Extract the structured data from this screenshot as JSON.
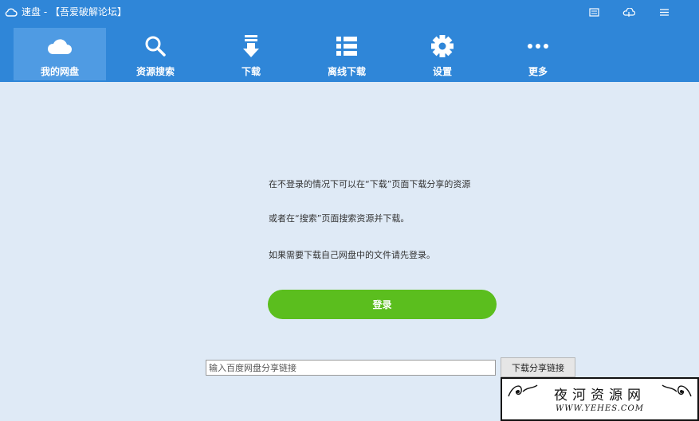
{
  "window": {
    "title": "速盘 - 【吾爱破解论坛】",
    "controls": [
      {
        "name": "feedback-icon"
      },
      {
        "name": "skin-icon"
      },
      {
        "name": "menu-icon"
      }
    ]
  },
  "nav": {
    "active": "我的网盘",
    "tabs": [
      {
        "label": "我的网盘",
        "icon": "cloud-icon"
      },
      {
        "label": "资源搜索",
        "icon": "search-icon"
      },
      {
        "label": "下载",
        "icon": "download-arrow-icon"
      },
      {
        "label": "离线下载",
        "icon": "list-icon"
      },
      {
        "label": "设置",
        "icon": "gear-icon"
      },
      {
        "label": "更多",
        "icon": "more-dots-icon"
      }
    ]
  },
  "main": {
    "messages": [
      "在不登录的情况下可以在“下载”页面下载分享的资源",
      "或者在“搜索”页面搜索资源并下载。",
      "如果需要下载自己网盘中的文件请先登录。"
    ],
    "login_label": "登录",
    "share_link_input": {
      "value": "",
      "placeholder": "输入百度网盘分享链接"
    },
    "download_link_label": "下载分享链接"
  },
  "watermark": {
    "title": "夜河资源网",
    "url": "WWW.YEHES.COM"
  },
  "colors": {
    "header_bg": "#2f86d8",
    "active_tab_bg": "#4f9be3",
    "content_bg": "#dfeaf6",
    "login_green": "#5bbe1e"
  }
}
